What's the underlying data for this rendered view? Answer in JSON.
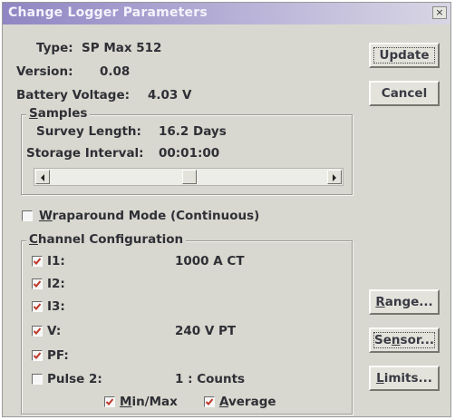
{
  "window": {
    "title": "Change Logger Parameters",
    "close_glyph": "×"
  },
  "info": {
    "type_label": "Type:",
    "type_value": "SP Max 512",
    "version_label": "Version:",
    "version_value": "0.08",
    "battery_label": "Battery Voltage:",
    "battery_value": "4.03 V"
  },
  "buttons": {
    "update": {
      "label": "Update"
    },
    "cancel": {
      "label": "Cancel"
    },
    "range": {
      "prefix": "",
      "accel": "R",
      "suffix": "ange..."
    },
    "sensor": {
      "prefix": "Se",
      "accel": "n",
      "suffix": "sor..."
    },
    "limits": {
      "prefix": "",
      "accel": "L",
      "suffix": "imits..."
    }
  },
  "samples": {
    "title_accel": "S",
    "title_rest": "amples",
    "survey_length_label": "Survey Length:",
    "survey_length_value": "16.2 Days",
    "storage_interval_label": "Storage Interval:",
    "storage_interval_value": "00:01:00",
    "slider_position": 0.5,
    "left_arrow_icon": "arrow-left-icon",
    "right_arrow_icon": "arrow-right-icon"
  },
  "wraparound": {
    "accel": "W",
    "rest": "raparound Mode (Continuous)",
    "checked": false
  },
  "channels": {
    "title_accel": "C",
    "title_rest": "hannel Configuration",
    "items": [
      {
        "label": "I1:",
        "value": "1000 A CT",
        "checked": true
      },
      {
        "label": "I2:",
        "value": "",
        "checked": true
      },
      {
        "label": "I3:",
        "value": "",
        "checked": true
      },
      {
        "label": "V:",
        "value": "240 V PT",
        "checked": true
      },
      {
        "label": "PF:",
        "value": "",
        "checked": true
      },
      {
        "label": "Pulse 2:",
        "value": "1 : Counts",
        "checked": false
      }
    ],
    "minmax": {
      "accel": "M",
      "rest": "in/Max",
      "checked": true
    },
    "average": {
      "accel": "A",
      "rest": "verage",
      "checked": true
    }
  },
  "colors": {
    "title_gradient_start": "#8f86c3",
    "dialog_face": "#d8d8d0",
    "check_color": "#c0392b"
  }
}
